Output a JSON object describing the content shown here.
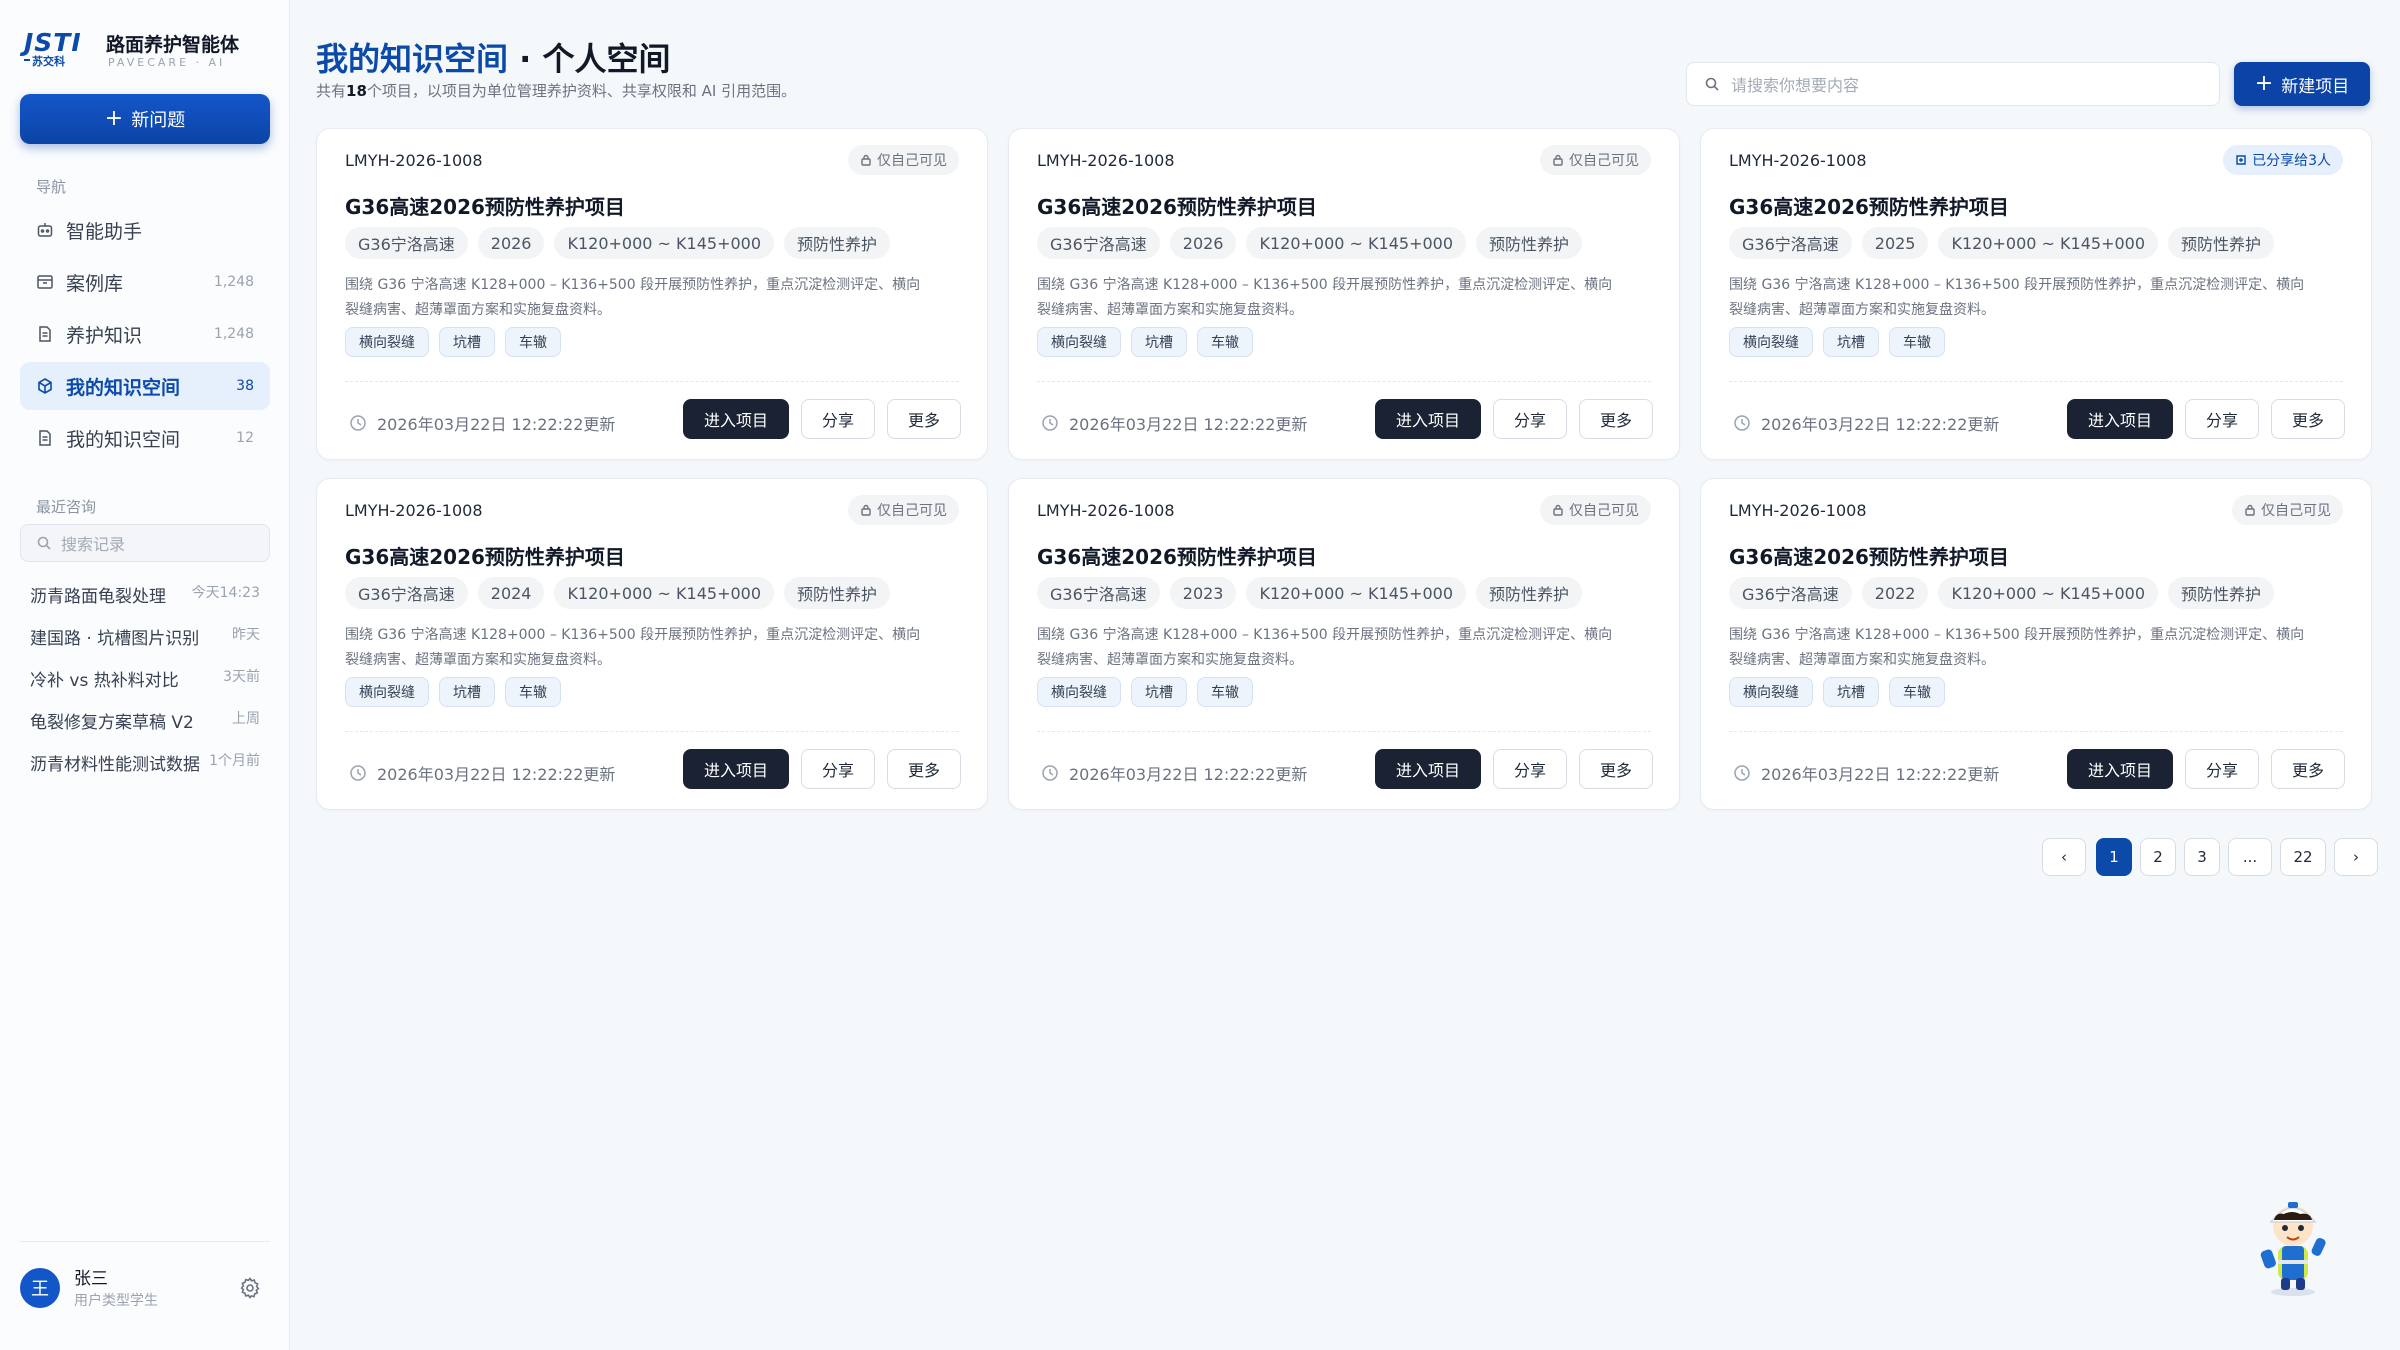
{
  "brand": {
    "logo_text": "JSTI",
    "logo_sub": "苏交科",
    "title": "路面养护智能体",
    "subtitle": "PAVECARE · AI"
  },
  "sidebar": {
    "new_question": "新问题",
    "nav_label": "导航",
    "nav": [
      {
        "label": "智能助手",
        "count": "",
        "icon": "robot-icon"
      },
      {
        "label": "案例库",
        "count": "1,248",
        "icon": "archive-icon"
      },
      {
        "label": "养护知识",
        "count": "1,248",
        "icon": "document-icon"
      },
      {
        "label": "我的知识空间",
        "count": "38",
        "icon": "cube-icon",
        "active": true
      },
      {
        "label": "我的知识空间",
        "count": "12",
        "icon": "document-icon"
      }
    ],
    "recent_label": "最近咨询",
    "search_placeholder": "搜索记录",
    "history": [
      {
        "title": "沥青路面龟裂处理",
        "time": "今天14:23"
      },
      {
        "title": "建国路 · 坑槽图片识别",
        "time": "昨天"
      },
      {
        "title": "冷补 vs 热补料对比",
        "time": "3天前"
      },
      {
        "title": "龟裂修复方案草稿 V2",
        "time": "上周"
      },
      {
        "title": "沥青材料性能测试数据",
        "time": "1个月前"
      }
    ],
    "user": {
      "avatar": "王",
      "name": "张三",
      "type": "用户类型学生"
    }
  },
  "header": {
    "title_highlight": "我的知识空间",
    "title_rest": " · 个人空间",
    "sub_prefix": "共有",
    "sub_count": "18",
    "sub_suffix": "个项目，以项目为单位管理养护资料、共享权限和 AI 引用范围。",
    "search_placeholder": "请搜索你想要内容",
    "new_project": "新建项目"
  },
  "cards": [
    {
      "code": "LMYH-2026-1008",
      "visibility": "仅自己可见",
      "shared": false,
      "title": "G36高速2026预防性养护项目",
      "tags": [
        "G36宁洛高速",
        "2026",
        "K120+000 ~ K145+000",
        "预防性养护"
      ],
      "desc": "围绕 G36 宁洛高速 K128+000 – K136+500 段开展预防性养护，重点沉淀检测评定、横向裂缝病害、超薄罩面方案和实施复盘资料。",
      "keywords": [
        "横向裂缝",
        "坑槽",
        "车辙"
      ],
      "updated": "2026年03月22日 12:22:22更新",
      "enter": "进入项目",
      "share": "分享",
      "more": "更多"
    },
    {
      "code": "LMYH-2026-1008",
      "visibility": "仅自己可见",
      "shared": false,
      "title": "G36高速2026预防性养护项目",
      "tags": [
        "G36宁洛高速",
        "2026",
        "K120+000 ~ K145+000",
        "预防性养护"
      ],
      "desc": "围绕 G36 宁洛高速 K128+000 – K136+500 段开展预防性养护，重点沉淀检测评定、横向裂缝病害、超薄罩面方案和实施复盘资料。",
      "keywords": [
        "横向裂缝",
        "坑槽",
        "车辙"
      ],
      "updated": "2026年03月22日 12:22:22更新",
      "enter": "进入项目",
      "share": "分享",
      "more": "更多"
    },
    {
      "code": "LMYH-2026-1008",
      "visibility": "已分享给3人",
      "shared": true,
      "title": "G36高速2026预防性养护项目",
      "tags": [
        "G36宁洛高速",
        "2025",
        "K120+000 ~ K145+000",
        "预防性养护"
      ],
      "desc": "围绕 G36 宁洛高速 K128+000 – K136+500 段开展预防性养护，重点沉淀检测评定、横向裂缝病害、超薄罩面方案和实施复盘资料。",
      "keywords": [
        "横向裂缝",
        "坑槽",
        "车辙"
      ],
      "updated": "2026年03月22日 12:22:22更新",
      "enter": "进入项目",
      "share": "分享",
      "more": "更多"
    },
    {
      "code": "LMYH-2026-1008",
      "visibility": "仅自己可见",
      "shared": false,
      "title": "G36高速2026预防性养护项目",
      "tags": [
        "G36宁洛高速",
        "2024",
        "K120+000 ~ K145+000",
        "预防性养护"
      ],
      "desc": "围绕 G36 宁洛高速 K128+000 – K136+500 段开展预防性养护，重点沉淀检测评定、横向裂缝病害、超薄罩面方案和实施复盘资料。",
      "keywords": [
        "横向裂缝",
        "坑槽",
        "车辙"
      ],
      "updated": "2026年03月22日 12:22:22更新",
      "enter": "进入项目",
      "share": "分享",
      "more": "更多"
    },
    {
      "code": "LMYH-2026-1008",
      "visibility": "仅自己可见",
      "shared": false,
      "title": "G36高速2026预防性养护项目",
      "tags": [
        "G36宁洛高速",
        "2023",
        "K120+000 ~ K145+000",
        "预防性养护"
      ],
      "desc": "围绕 G36 宁洛高速 K128+000 – K136+500 段开展预防性养护，重点沉淀检测评定、横向裂缝病害、超薄罩面方案和实施复盘资料。",
      "keywords": [
        "横向裂缝",
        "坑槽",
        "车辙"
      ],
      "updated": "2026年03月22日 12:22:22更新",
      "enter": "进入项目",
      "share": "分享",
      "more": "更多"
    },
    {
      "code": "LMYH-2026-1008",
      "visibility": "仅自己可见",
      "shared": false,
      "title": "G36高速2026预防性养护项目",
      "tags": [
        "G36宁洛高速",
        "2022",
        "K120+000 ~ K145+000",
        "预防性养护"
      ],
      "desc": "围绕 G36 宁洛高速 K128+000 – K136+500 段开展预防性养护，重点沉淀检测评定、横向裂缝病害、超薄罩面方案和实施复盘资料。",
      "keywords": [
        "横向裂缝",
        "坑槽",
        "车辙"
      ],
      "updated": "2026年03月22日 12:22:22更新",
      "enter": "进入项目",
      "share": "分享",
      "more": "更多"
    }
  ],
  "pagination": {
    "prev": "‹",
    "pages": [
      "1",
      "2",
      "3",
      "...",
      "22"
    ],
    "current": "1",
    "next": "›"
  },
  "colors": {
    "primary": "#0b4aa8",
    "dark_button": "#1a2233",
    "active_nav_bg": "#e6effc"
  }
}
